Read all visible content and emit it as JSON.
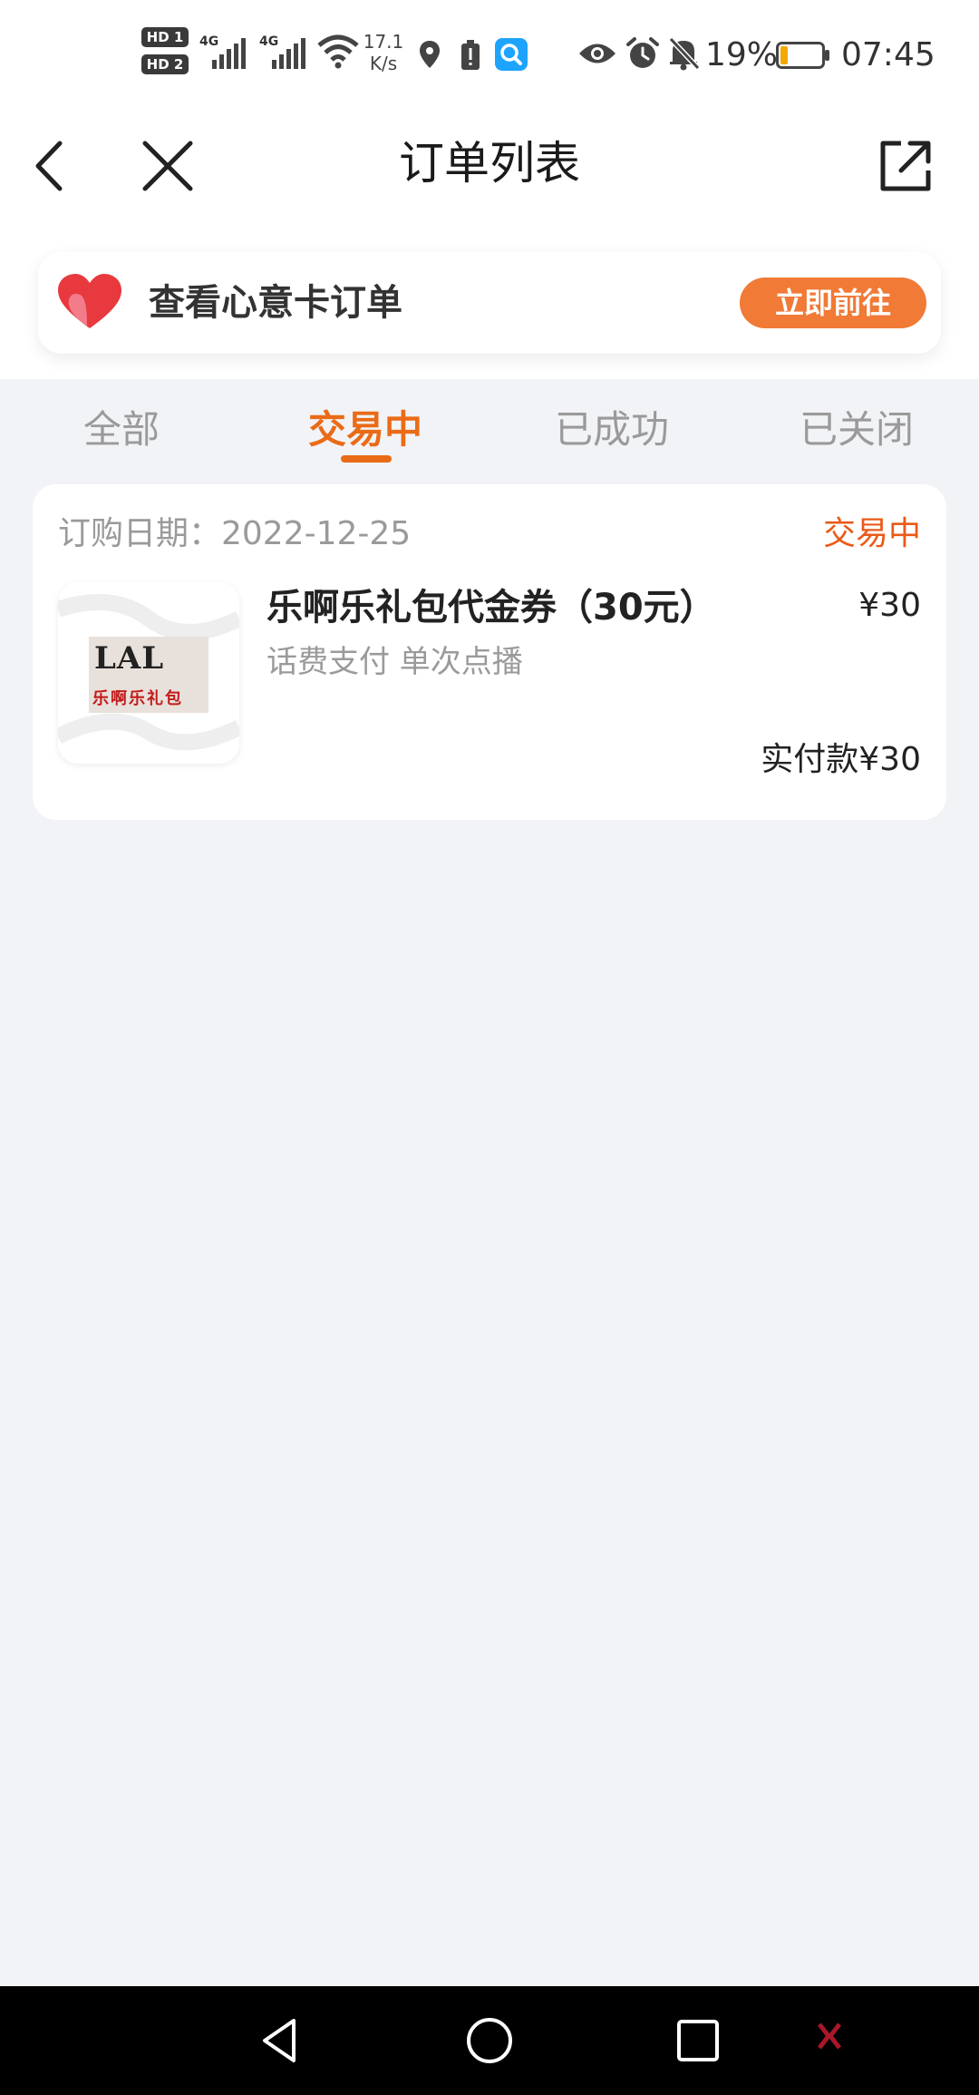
{
  "status_bar": {
    "sim1": "HD 1",
    "sim2": "HD 2",
    "network1": "4G",
    "network2": "4G",
    "speed_value": "17.1",
    "speed_unit": "K/s",
    "battery_percent": "19%",
    "battery_level": 0.19,
    "time": "07:45",
    "icons": [
      "signal-icon",
      "wifi-icon",
      "location-icon",
      "battery-alert-icon",
      "search-app-icon",
      "eye-icon",
      "alarm-icon",
      "mute-icon",
      "battery-icon"
    ]
  },
  "header": {
    "title": "订单列表",
    "back_icon": "chevron-left-icon",
    "close_icon": "close-icon",
    "share_icon": "share-icon"
  },
  "banner": {
    "text": "查看心意卡订单",
    "button": "立即前往",
    "icon": "heart-icon",
    "accent": "#f07a36"
  },
  "tabs": [
    {
      "label": "全部",
      "active": false
    },
    {
      "label": "交易中",
      "active": true
    },
    {
      "label": "已成功",
      "active": false
    },
    {
      "label": "已关闭",
      "active": false
    }
  ],
  "orders": [
    {
      "date": "订购日期：2022-12-25",
      "status": "交易中",
      "logo_mark": "LAL",
      "logo_name": "乐啊乐礼包",
      "product_name": "乐啊乐礼包代金券（30元）",
      "price": "¥30",
      "description": "话费支付 单次点播",
      "paid": "实付款¥30"
    }
  ],
  "colors": {
    "accent": "#ea6b17",
    "status": "#ea5a17",
    "background": "#f2f3f6"
  },
  "system_nav": {
    "icons": [
      "back-triangle-icon",
      "home-circle-icon",
      "recent-square-icon"
    ]
  }
}
